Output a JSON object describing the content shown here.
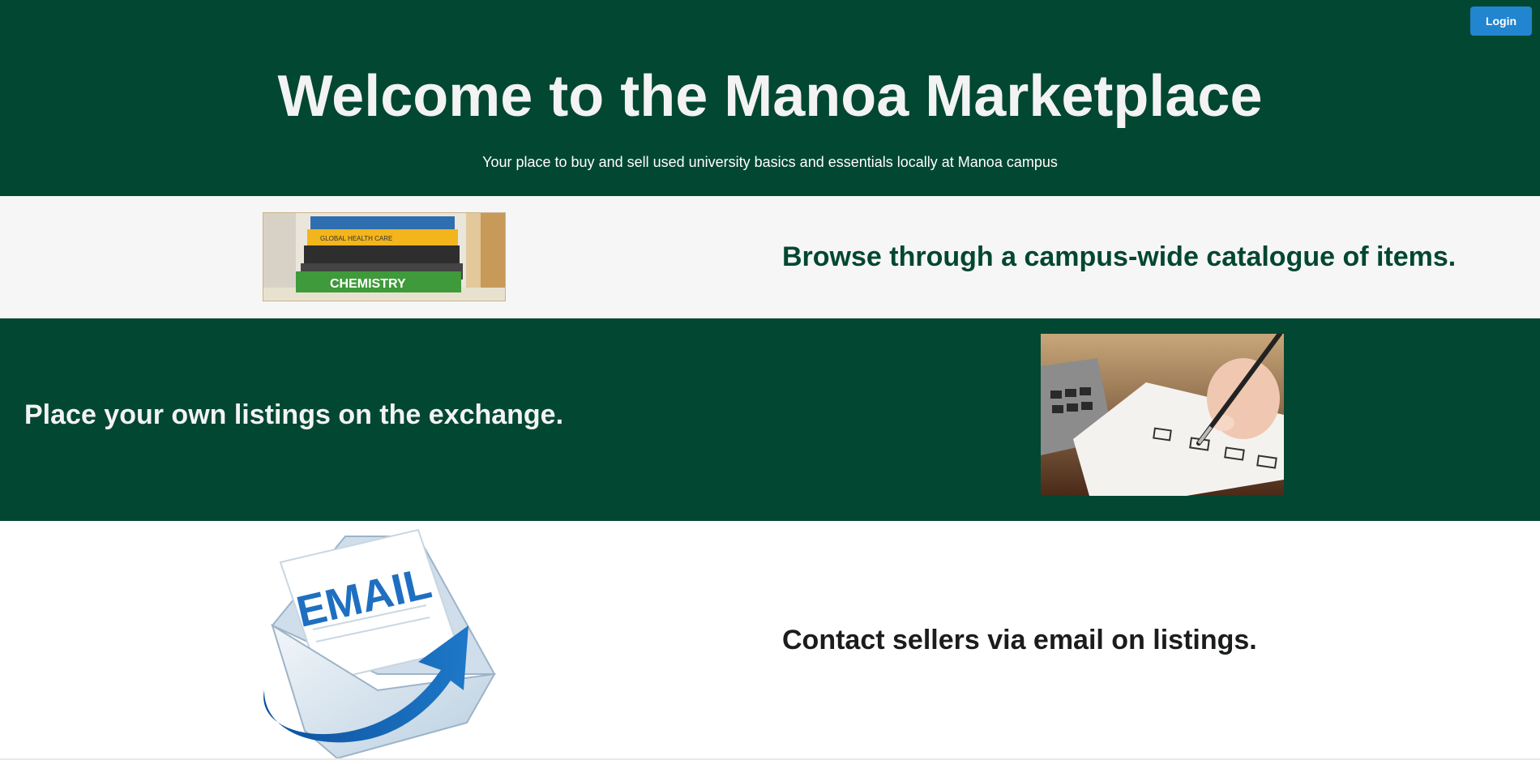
{
  "header": {
    "login_label": "Login",
    "title": "Welcome to the Manoa Marketplace",
    "subtitle": "Your place to buy and sell used university basics and essentials locally at Manoa campus"
  },
  "sections": {
    "browse": {
      "heading": "Browse through a campus-wide catalogue of items.",
      "image_icon": "textbook-stack-image",
      "book_spine_labels": [
        "GLOBAL HEALTH CARE",
        "CHEMISTRY"
      ]
    },
    "place": {
      "heading": "Place your own listings on the exchange.",
      "image_icon": "checklist-pen-image"
    },
    "contact": {
      "heading": "Contact sellers via email on listings.",
      "image_icon": "email-envelope-image",
      "image_text": "EMAIL"
    }
  },
  "colors": {
    "brand_green": "#024731",
    "light_band": "#f6f6f6",
    "button_blue": "#2185d0"
  }
}
